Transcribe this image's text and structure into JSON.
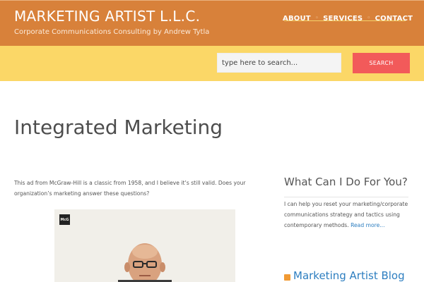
{
  "header": {
    "site_title": "MARKETING ARTIST L.L.C.",
    "tagline": "Corporate Communications Consulting by Andrew Tytla",
    "nav": [
      "ABOUT",
      "SERVICES",
      "CONTACT"
    ],
    "nav_separator": "◦"
  },
  "search": {
    "placeholder": "type here to search...",
    "button_label": "SEARCH"
  },
  "main": {
    "page_title": "Integrated Marketing",
    "intro_text": "This ad from McGraw-Hill is a classic from 1958, and I believe it’s still valid. Does your organization’s marketing answer these questions?",
    "ad_logo_text": "McG"
  },
  "sidebar": {
    "heading": "What Can I Do For You?",
    "text": "I can help you reset your marketing/corporate communications strategy and tactics using contemporary methods.",
    "read_more": "Read more...",
    "blog_heading": "Marketing Artist Blog"
  },
  "colors": {
    "header_bg": "#d8813a",
    "search_bar_bg": "#fbd767",
    "search_button_bg": "#f25a5a",
    "link": "#2d7ec0",
    "rss_icon": "#f19a34"
  }
}
